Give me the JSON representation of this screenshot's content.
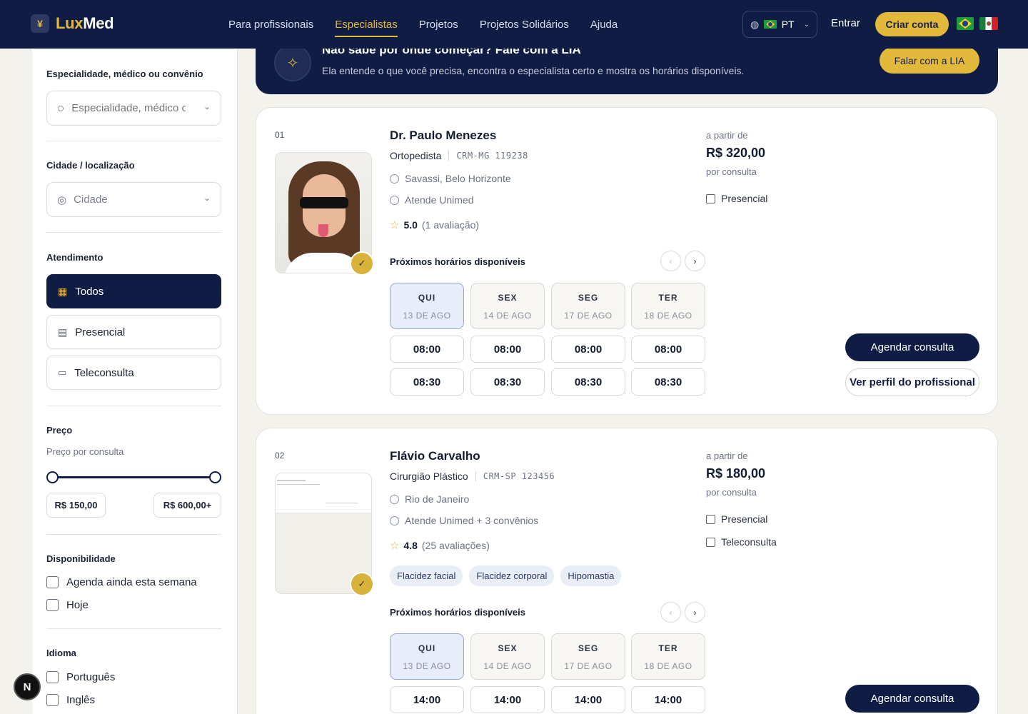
{
  "header": {
    "logo_lux": "Lux",
    "logo_med": "Med",
    "nav": [
      "Para profissionais",
      "Especialistas",
      "Projetos",
      "Projetos Solidários",
      "Ajuda"
    ],
    "active_nav": "Especialistas",
    "lang": "PT",
    "login": "Entrar",
    "signup": "Criar conta"
  },
  "sidebar": {
    "search_title": "Especialidade, médico ou convênio",
    "search_placeholder": "Especialidade, médico ou convênio",
    "city_title": "Cidade / localização",
    "city_placeholder": "Cidade",
    "attendance_title": "Atendimento",
    "attendance_options": [
      "Todos",
      "Presencial",
      "Teleconsulta"
    ],
    "attendance_selected": "Todos",
    "price_title": "Preço",
    "price_sub": "Preço por consulta",
    "price_min": "R$ 150,00",
    "price_max": "R$ 600,00+",
    "availability_title": "Disponibilidade",
    "availability_options": [
      "Agenda ainda esta semana",
      "Hoje"
    ],
    "language_title": "Idioma",
    "language_options": [
      "Português",
      "Inglês"
    ]
  },
  "banner": {
    "title": "Não sabe por onde começar? Fale com a LIA",
    "text": "Ela entende o que você precisa, encontra o especialista certo e mostra os horários disponíveis.",
    "button": "Falar com a LIA"
  },
  "doctors": [
    {
      "index": "01",
      "name": "Dr. Paulo Menezes",
      "specialty": "Ortopedista",
      "crm": "CRM-MG 119238",
      "location": "Savassi, Belo Horizonte",
      "insurance": "Atende Unimed",
      "rating": "5.0",
      "reviews": "(1 avaliação)",
      "price_from": "a partir de",
      "price": "R$ 320,00",
      "price_unit": "por consulta",
      "modes": [
        "Presencial"
      ],
      "slots_title": "Próximos horários disponíveis",
      "days": [
        {
          "dow": "QUI",
          "date": "13 DE AGO"
        },
        {
          "dow": "SEX",
          "date": "14 DE AGO"
        },
        {
          "dow": "SEG",
          "date": "17 DE AGO"
        },
        {
          "dow": "TER",
          "date": "18 DE AGO"
        }
      ],
      "times": [
        [
          "08:00",
          "08:00",
          "08:00",
          "08:00"
        ],
        [
          "08:30",
          "08:30",
          "08:30",
          "08:30"
        ]
      ],
      "book": "Agendar consulta",
      "profile": "Ver perfil do profissional"
    },
    {
      "index": "02",
      "name": "Flávio Carvalho",
      "specialty": "Cirurgião Plástico",
      "crm": "CRM-SP 123456",
      "location": "Rio de Janeiro",
      "insurance": "Atende Unimed + 3 convênios",
      "rating": "4.8",
      "reviews": "(25 avaliações)",
      "tags": [
        "Flacidez facial",
        "Flacidez corporal",
        "Hipomastia"
      ],
      "price_from": "a partir de",
      "price": "R$ 180,00",
      "price_unit": "por consulta",
      "modes": [
        "Presencial",
        "Teleconsulta"
      ],
      "slots_title": "Próximos horários disponíveis",
      "days": [
        {
          "dow": "QUI",
          "date": "13 DE AGO"
        },
        {
          "dow": "SEX",
          "date": "14 DE AGO"
        },
        {
          "dow": "SEG",
          "date": "17 DE AGO"
        },
        {
          "dow": "TER",
          "date": "18 DE AGO"
        }
      ],
      "times": [
        [
          "14:00",
          "14:00",
          "14:00",
          "14:00"
        ]
      ],
      "book": "Agendar consulta"
    }
  ],
  "fab": "N",
  "colors": {
    "navy": "#0f1d45",
    "gold": "#e3b93c",
    "background": "#f4f2ed"
  }
}
